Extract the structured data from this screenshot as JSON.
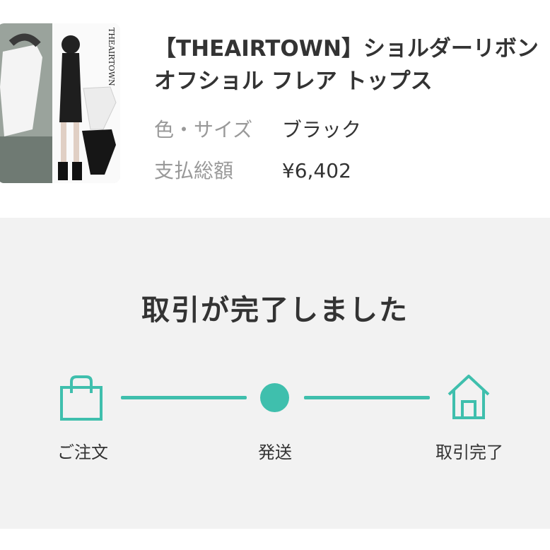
{
  "product": {
    "image_brand_text": "THEAIRTOWN",
    "title_line1": "【THEAIRTOWN】ショルダーリボン",
    "title_line2": "オフショル フレア トップス",
    "color_size_label": "色・サイズ",
    "color_size_value": "ブラック",
    "total_label": "支払総額",
    "total_value": "¥6,402"
  },
  "status": {
    "heading": "取引が完了しました",
    "steps": [
      {
        "label": "ご注文",
        "icon": "shopping-bag-icon"
      },
      {
        "label": "発送",
        "icon": "progress-dot"
      },
      {
        "label": "取引完了",
        "icon": "house-icon"
      }
    ],
    "accent_color": "#3fbfad"
  }
}
